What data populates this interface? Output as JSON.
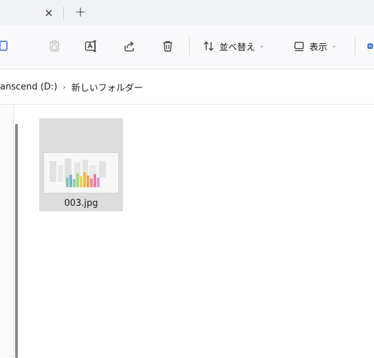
{
  "tabs": {
    "close_glyph": "×",
    "new_glyph": "+"
  },
  "toolbar": {
    "sort_label": "並べ替え",
    "view_label": "表示",
    "dropdown_glyph": "⌄",
    "accent_color": "#2b6cd1"
  },
  "breadcrumb": {
    "drive": "anscend (D:)",
    "separator": "›",
    "folder": "新しいフォルダー"
  },
  "files": [
    {
      "name": "003.jpg",
      "selected": true
    }
  ]
}
